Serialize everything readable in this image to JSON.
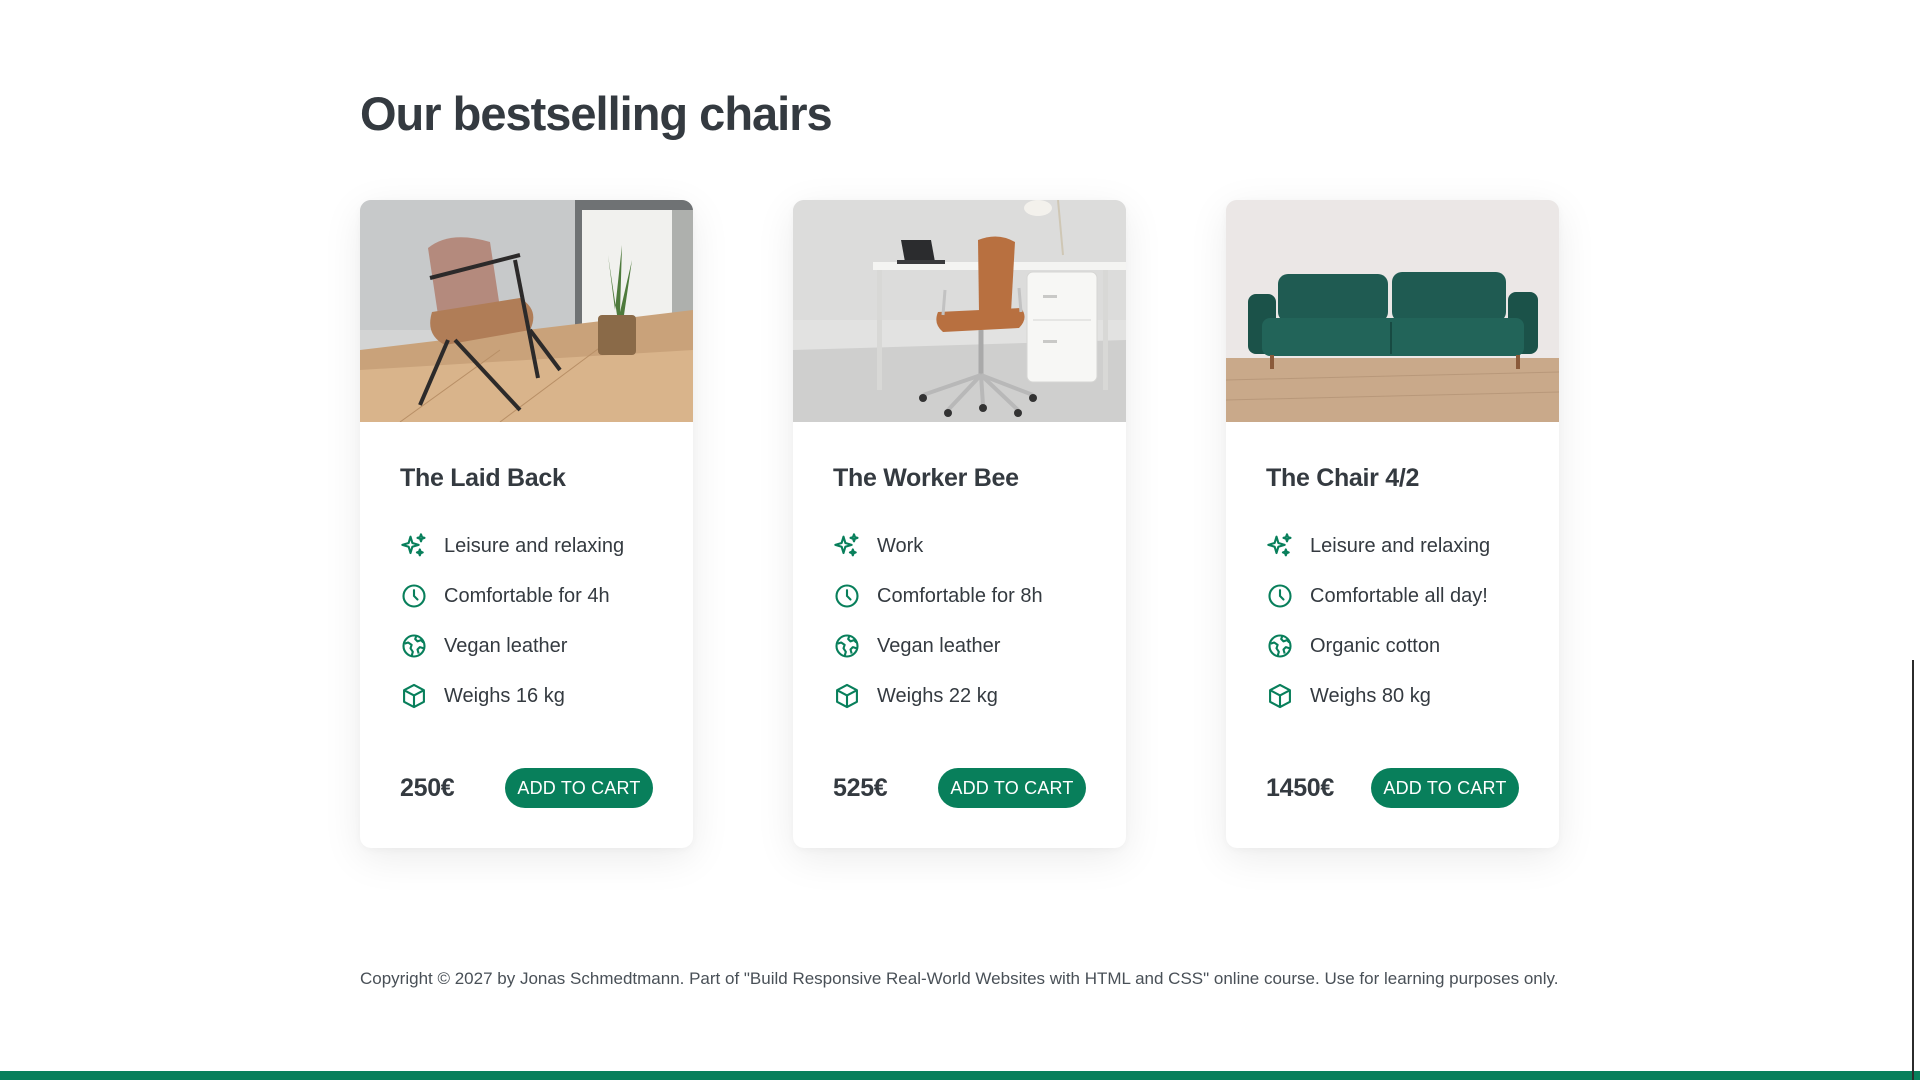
{
  "section": {
    "title": "Our bestselling chairs"
  },
  "products": [
    {
      "name": "The Laid Back",
      "features": [
        {
          "icon": "sparkles-icon",
          "text": "Leisure and relaxing"
        },
        {
          "icon": "clock-icon",
          "text": "Comfortable for 4h"
        },
        {
          "icon": "globe-icon",
          "text": "Vegan leather"
        },
        {
          "icon": "cube-icon",
          "text": "Weighs 16 kg"
        }
      ],
      "price": "250€",
      "cta": "ADD TO CART"
    },
    {
      "name": "The Worker Bee",
      "features": [
        {
          "icon": "sparkles-icon",
          "text": "Work"
        },
        {
          "icon": "clock-icon",
          "text": "Comfortable for 8h"
        },
        {
          "icon": "globe-icon",
          "text": "Vegan leather"
        },
        {
          "icon": "cube-icon",
          "text": "Weighs 22 kg"
        }
      ],
      "price": "525€",
      "cta": "ADD TO CART"
    },
    {
      "name": "The Chair 4/2",
      "features": [
        {
          "icon": "sparkles-icon",
          "text": "Leisure and relaxing"
        },
        {
          "icon": "clock-icon",
          "text": "Comfortable all day!"
        },
        {
          "icon": "globe-icon",
          "text": "Organic cotton"
        },
        {
          "icon": "cube-icon",
          "text": "Weighs 80 kg"
        }
      ],
      "price": "1450€",
      "cta": "ADD TO CART"
    }
  ],
  "footer": {
    "copyright": "Copyright © 2027 by Jonas Schmedtmann. Part of \"Build Responsive Real-World Websites with HTML and CSS\" online course. Use for learning purposes only."
  },
  "colors": {
    "accent": "#087f5b",
    "text": "#343a40"
  }
}
